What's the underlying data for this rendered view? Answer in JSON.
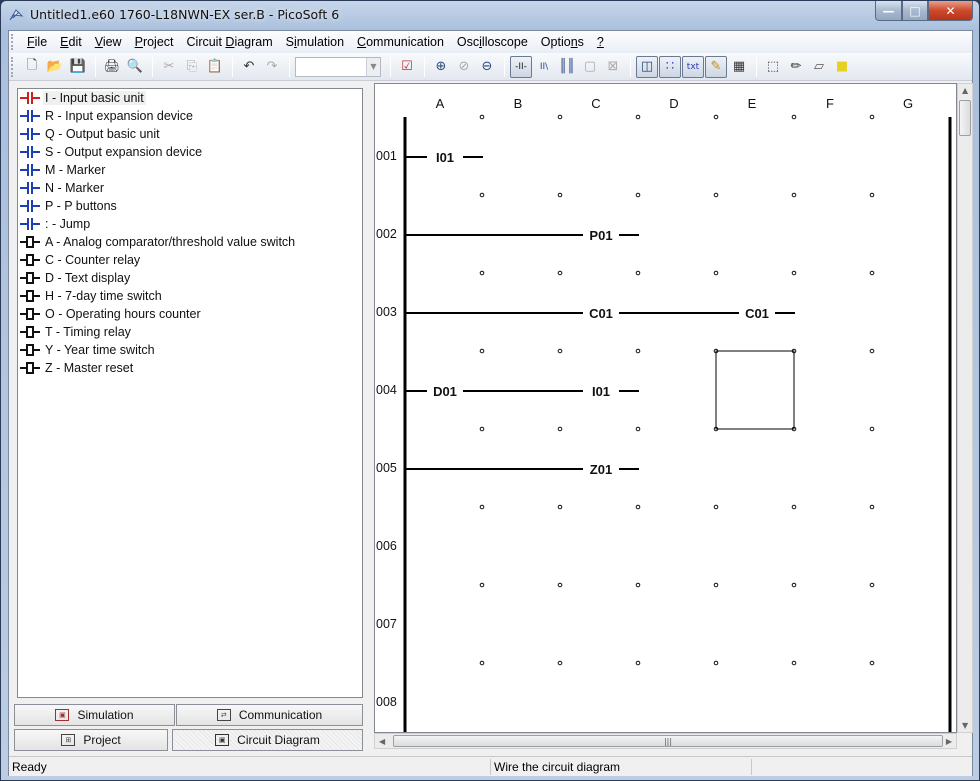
{
  "window": {
    "title": "Untitled1.e60 1760-L18NWN-EX ser.B - PicoSoft 6",
    "controls": {
      "minimize": "—",
      "maximize": "□",
      "close": "✕"
    }
  },
  "menu": [
    "File",
    "Edit",
    "View",
    "Project",
    "Circuit Diagram",
    "Simulation",
    "Communication",
    "Oscilloscope",
    "Options",
    "?"
  ],
  "toolbar": {
    "combo_value": "",
    "buttons": [
      {
        "name": "new-icon",
        "glyph": "🗋"
      },
      {
        "name": "open-icon",
        "glyph": "📂"
      },
      {
        "name": "save-icon",
        "glyph": "💾"
      },
      {
        "name": "print-icon",
        "glyph": "🖨"
      },
      {
        "name": "print-preview-icon",
        "glyph": "🔍"
      },
      {
        "name": "cut-icon",
        "glyph": "✂"
      },
      {
        "name": "copy-icon",
        "glyph": "⎘"
      },
      {
        "name": "paste-icon",
        "glyph": "📋"
      },
      {
        "name": "undo-icon",
        "glyph": "↶"
      },
      {
        "name": "redo-icon",
        "glyph": "↷"
      },
      {
        "name": "check-icon",
        "glyph": "☑"
      },
      {
        "name": "zoom-in-icon",
        "glyph": "⊕"
      },
      {
        "name": "zoom-fit-icon",
        "glyph": "⊘"
      },
      {
        "name": "zoom-out-icon",
        "glyph": "⊖"
      },
      {
        "name": "contact-mode-icon",
        "glyph": "-II-"
      },
      {
        "name": "wire-mode-icon",
        "glyph": "II\\"
      },
      {
        "name": "insert-contact-icon",
        "glyph": "║║"
      },
      {
        "name": "insert-coil-icon",
        "glyph": "▢"
      },
      {
        "name": "delete-element-icon",
        "glyph": "⊠"
      },
      {
        "name": "layout-view-icon",
        "glyph": "◫"
      },
      {
        "name": "grid-icon",
        "glyph": "∷"
      },
      {
        "name": "text-contact-icon",
        "glyph": "txt"
      },
      {
        "name": "note-icon",
        "glyph": "✎"
      },
      {
        "name": "table-icon",
        "glyph": "▦"
      },
      {
        "name": "select-rect-icon",
        "glyph": "⬚"
      },
      {
        "name": "pencil-icon",
        "glyph": "✏"
      },
      {
        "name": "eraser-icon",
        "glyph": "▱"
      },
      {
        "name": "comment-icon",
        "glyph": "■"
      }
    ]
  },
  "tree": {
    "items": [
      {
        "label": "I - Input basic unit",
        "icon": "contact",
        "color": "#cc2020",
        "selected": true
      },
      {
        "label": "R - Input expansion device",
        "icon": "contact",
        "color": "#1d3fb5"
      },
      {
        "label": "Q - Output basic unit",
        "icon": "contact",
        "color": "#1d3fb5"
      },
      {
        "label": "S - Output expansion device",
        "icon": "contact",
        "color": "#1d3fb5"
      },
      {
        "label": "M - Marker",
        "icon": "contact",
        "color": "#1d3fb5"
      },
      {
        "label": "N - Marker",
        "icon": "contact",
        "color": "#1d3fb5"
      },
      {
        "label": "P - P buttons",
        "icon": "contact",
        "color": "#1d3fb5"
      },
      {
        "label": ": - Jump",
        "icon": "contact",
        "color": "#1d3fb5"
      },
      {
        "label": "A - Analog comparator/threshold value switch",
        "icon": "box"
      },
      {
        "label": "C - Counter relay",
        "icon": "box"
      },
      {
        "label": "D - Text display",
        "icon": "box"
      },
      {
        "label": "H - 7-day time switch",
        "icon": "box"
      },
      {
        "label": "O - Operating hours counter",
        "icon": "box"
      },
      {
        "label": "T - Timing relay",
        "icon": "box"
      },
      {
        "label": "Y - Year time switch",
        "icon": "box"
      },
      {
        "label": "Z - Master reset",
        "icon": "box"
      }
    ]
  },
  "panel_tabs": {
    "simulation": "Simulation",
    "communication": "Communication",
    "project": "Project",
    "circuit_diagram": "Circuit Diagram",
    "active": "circuit_diagram"
  },
  "diagram": {
    "columns": [
      "A",
      "B",
      "C",
      "D",
      "E",
      "F",
      "G"
    ],
    "rows": [
      "001",
      "002",
      "003",
      "004",
      "005",
      "006",
      "007",
      "008"
    ],
    "rungs": [
      {
        "row": "001",
        "contacts": [
          {
            "col": "A",
            "label": "I01"
          }
        ],
        "wire_cols": []
      },
      {
        "row": "002",
        "contacts": [
          {
            "col": "C",
            "label": "P01"
          }
        ],
        "wire_cols": [
          "A",
          "B"
        ]
      },
      {
        "row": "003",
        "contacts": [
          {
            "col": "C",
            "label": "C01"
          },
          {
            "col": "E",
            "label": "C01"
          }
        ],
        "wire_cols": [
          "A",
          "B",
          "D"
        ]
      },
      {
        "row": "004",
        "contacts": [
          {
            "col": "A",
            "label": "D01"
          },
          {
            "col": "C",
            "label": "I01"
          }
        ],
        "wire_cols": [
          "B"
        ]
      },
      {
        "row": "005",
        "contacts": [
          {
            "col": "C",
            "label": "Z01"
          }
        ],
        "wire_cols": [
          "A",
          "B"
        ]
      }
    ],
    "selection": {
      "col": "E",
      "row": "005"
    }
  },
  "status": {
    "left": "Ready",
    "center": "Wire the circuit diagram",
    "right": ""
  }
}
